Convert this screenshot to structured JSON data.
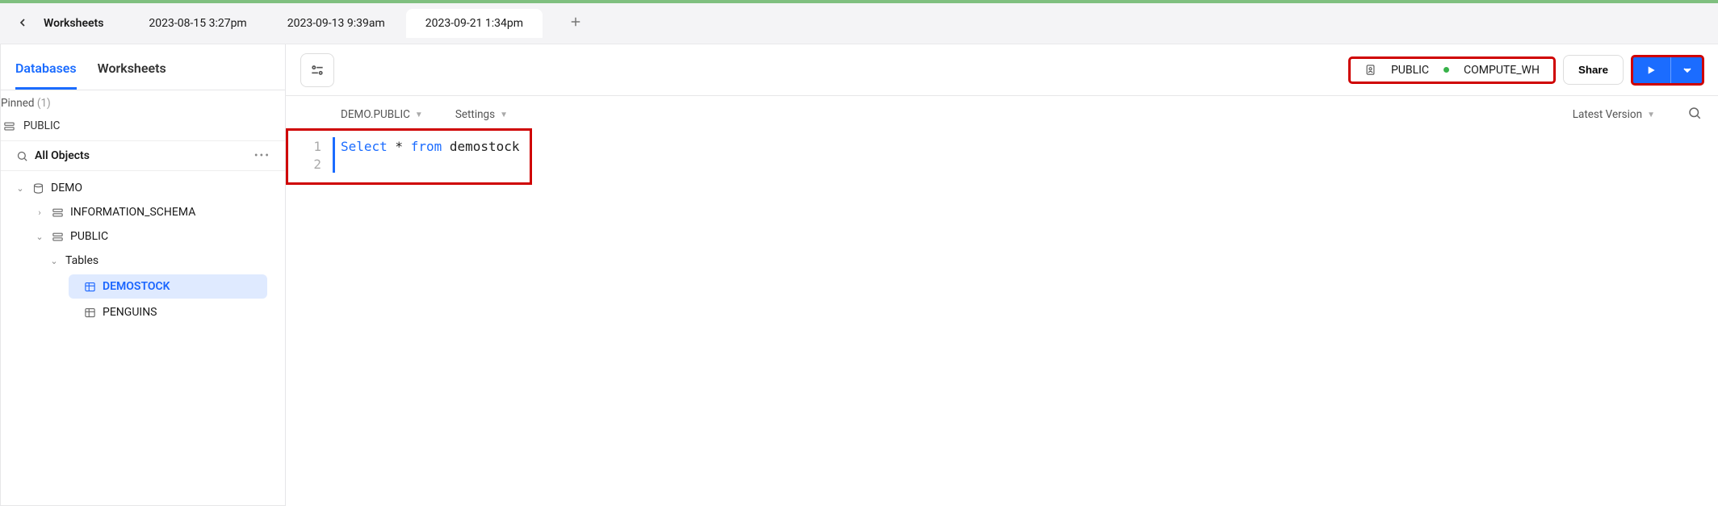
{
  "topbar": {
    "back_label": "Worksheets",
    "tabs": [
      {
        "label": "2023-08-15 3:27pm",
        "active": false
      },
      {
        "label": "2023-09-13 9:39am",
        "active": false
      },
      {
        "label": "2023-09-21 1:34pm",
        "active": true
      }
    ]
  },
  "left": {
    "tabs": {
      "databases": "Databases",
      "worksheets": "Worksheets"
    },
    "pinned_label": "Pinned",
    "pinned_count": "(1)",
    "pinned_items": [
      "PUBLIC"
    ],
    "all_objects_label": "All Objects",
    "tree": {
      "db": "DEMO",
      "schemas": [
        "INFORMATION_SCHEMA",
        "PUBLIC"
      ],
      "tables_label": "Tables",
      "tables": [
        "DEMOSTOCK",
        "PENGUINS"
      ],
      "selected": "DEMOSTOCK"
    }
  },
  "toolbar": {
    "context_role": "PUBLIC",
    "context_wh": "COMPUTE_WH",
    "share_label": "Share"
  },
  "options": {
    "schema": "DEMO.PUBLIC",
    "settings_label": "Settings",
    "version_label": "Latest Version"
  },
  "editor": {
    "lines": [
      {
        "n": 1,
        "tokens": [
          [
            "kw",
            "Select"
          ],
          [
            "tk",
            " * "
          ],
          [
            "kw",
            "from"
          ],
          [
            "tk",
            " demostock"
          ]
        ]
      },
      {
        "n": 2,
        "tokens": []
      }
    ]
  }
}
